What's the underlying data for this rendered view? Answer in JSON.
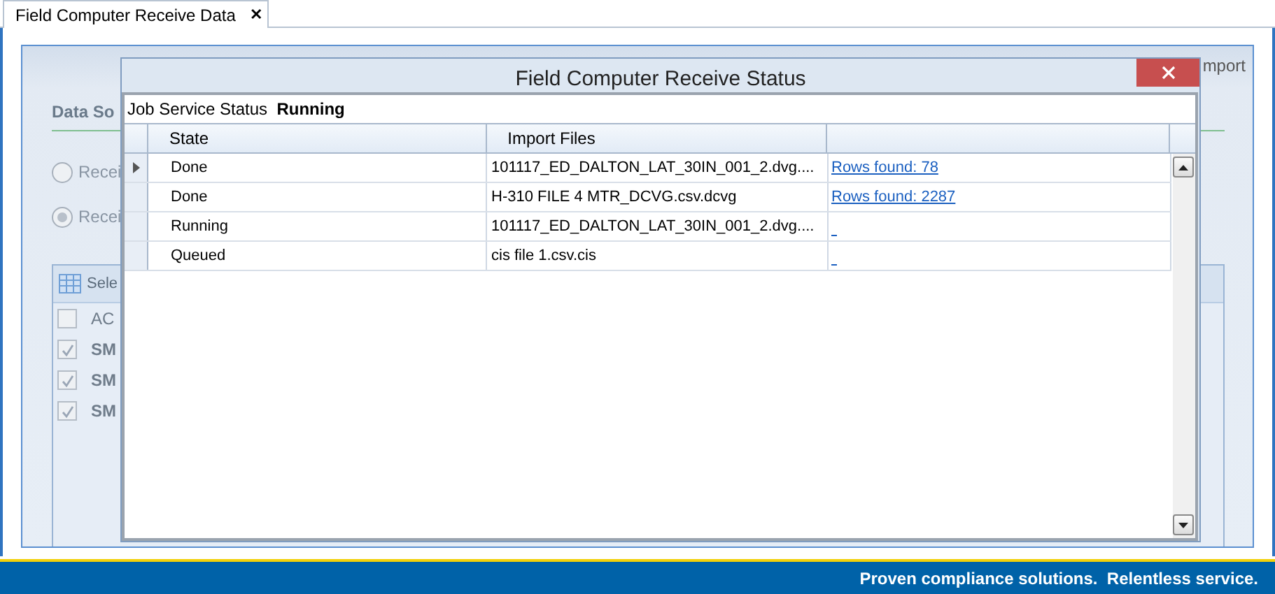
{
  "tab": {
    "label": "Field Computer Receive Data",
    "close": "✕",
    "selected": true
  },
  "toolbar": {
    "import_label": "mport"
  },
  "background": {
    "section_title": "Data So",
    "radios": [
      {
        "label": "Recei",
        "selected": false
      },
      {
        "label": "Recei",
        "selected": true
      }
    ],
    "list_header": "Sele",
    "checkboxes": [
      {
        "label": "AC",
        "checked": false
      },
      {
        "label": "SM",
        "checked": true
      },
      {
        "label": "SM",
        "checked": true
      },
      {
        "label": "SM",
        "checked": true
      }
    ]
  },
  "dialog": {
    "title": "Field Computer Receive Status",
    "job_status_label": "Job Service Status",
    "job_status": "Running",
    "columns": [
      "State",
      "Import Files"
    ],
    "rows": [
      {
        "state": "Done",
        "file": "101117_ED_DALTON_LAT_30IN_001_2.dvg....",
        "result": "Rows found: 78",
        "selected": true
      },
      {
        "state": "Done",
        "file": "H-310 FILE 4 MTR_DCVG.csv.dcvg",
        "result": "Rows found: 2287",
        "selected": false
      },
      {
        "state": "Running",
        "file": "101117_ED_DALTON_LAT_30IN_001_2.dvg....",
        "selected": false
      },
      {
        "state": "Queued",
        "file": "cis file 1.csv.cis",
        "selected": false
      }
    ]
  },
  "footer": {
    "slogan": "Proven compliance solutions.  Relentless service."
  }
}
